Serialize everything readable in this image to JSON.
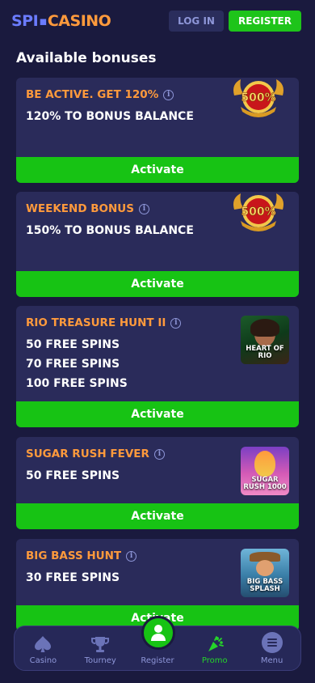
{
  "header": {
    "logo_part1": "SPI",
    "logo_part2": "CASINO",
    "login_label": "LOG IN",
    "register_label": "REGISTER"
  },
  "section_title": "Available bonuses",
  "bonuses": [
    {
      "title": "BE ACTIVE. GET 120%",
      "lines": [
        "120% TO BONUS BALANCE"
      ],
      "image": "500-percent-badge",
      "image_text": "500%",
      "activate_label": "Activate"
    },
    {
      "title": "WEEKEND BONUS",
      "lines": [
        "150% TO BONUS BALANCE"
      ],
      "image": "500-percent-badge",
      "image_text": "500%",
      "activate_label": "Activate"
    },
    {
      "title": "RIO TREASURE HUNT II",
      "lines": [
        "50 FREE SPINS",
        "70 FREE SPINS",
        "100 FREE SPINS"
      ],
      "image": "heart-of-rio-game-thumbnail",
      "image_text": "HEART OF RIO",
      "activate_label": "Activate"
    },
    {
      "title": "SUGAR RUSH FEVER",
      "lines": [
        "50 FREE SPINS"
      ],
      "image": "sugar-rush-1000-game-thumbnail",
      "image_text": "SUGAR RUSH 1000",
      "activate_label": "Activate"
    },
    {
      "title": "BIG BASS HUNT",
      "lines": [
        "30 FREE SPINS"
      ],
      "image": "big-bass-splash-game-thumbnail",
      "image_text": "BIG BASS SPLASH",
      "activate_label": "Activate"
    }
  ],
  "nav": {
    "items": [
      {
        "label": "Casino",
        "icon": "spade-icon"
      },
      {
        "label": "Tourney",
        "icon": "trophy-icon"
      },
      {
        "label": "Register",
        "icon": "user-icon"
      },
      {
        "label": "Promo",
        "icon": "promo-icon",
        "active": true
      },
      {
        "label": "Menu",
        "icon": "menu-icon"
      }
    ]
  },
  "colors": {
    "background": "#1a1a3e",
    "card": "#2a2b5a",
    "accent_orange": "#ff9a3c",
    "accent_green": "#17c314",
    "muted": "#8e96d8"
  }
}
